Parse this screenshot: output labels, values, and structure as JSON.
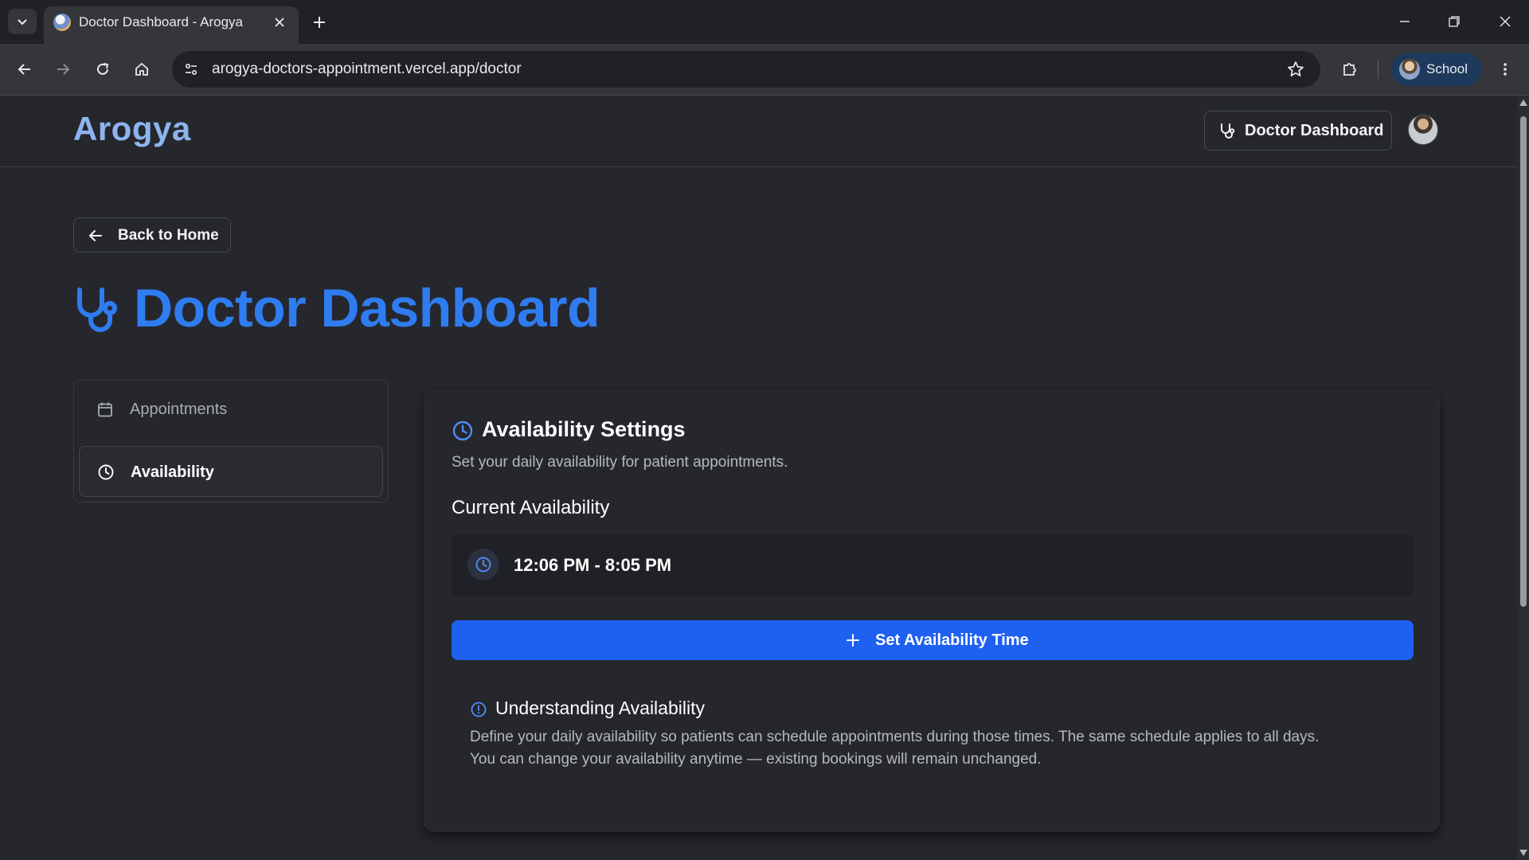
{
  "browser": {
    "tab_title": "Doctor Dashboard - Arogya",
    "url": "arogya-doctors-appointment.vercel.app/doctor",
    "profile_name": "School"
  },
  "header": {
    "brand": "Arogya",
    "dashboard_button": "Doctor Dashboard"
  },
  "page": {
    "back_label": "Back to Home",
    "title": "Doctor Dashboard"
  },
  "sidebar": {
    "items": [
      {
        "label": "Appointments",
        "icon": "calendar-icon",
        "active": false
      },
      {
        "label": "Availability",
        "icon": "clock-icon",
        "active": true
      }
    ]
  },
  "availability": {
    "title": "Availability Settings",
    "subtitle": "Set your daily availability for patient appointments.",
    "current_heading": "Current Availability",
    "current_time": "12:06 PM - 8:05 PM",
    "set_button": "Set Availability Time",
    "info_title": "Understanding Availability",
    "info_line1": "Define your daily availability so patients can schedule appointments during those times. The same schedule applies to all days.",
    "info_line2": "You can change your availability anytime — existing bookings will remain unchanged."
  },
  "colors": {
    "brand": "#8db4ee",
    "accent": "#2f7cf0",
    "primary_button": "#1e60f0",
    "background": "#25272d"
  }
}
